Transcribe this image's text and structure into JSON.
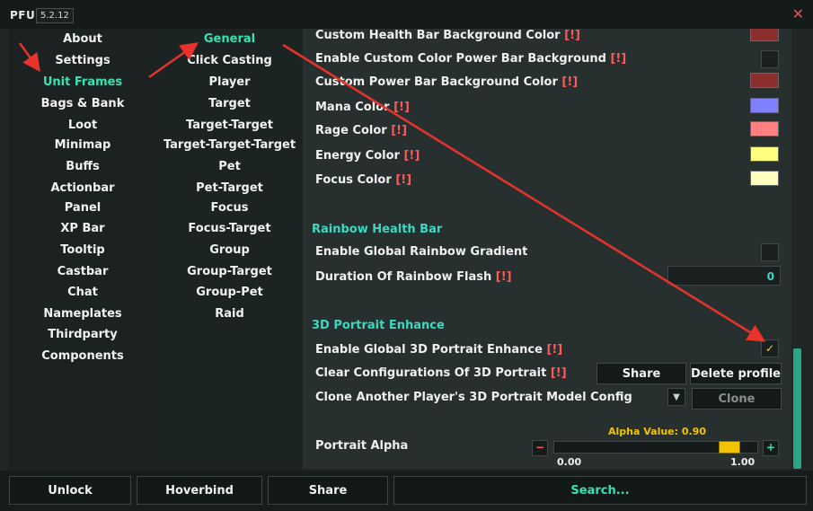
{
  "window": {
    "logo": "PFUI",
    "version": "5.2.12"
  },
  "nav1": {
    "items": [
      "About",
      "Settings",
      "Unit Frames",
      "Bags & Bank",
      "Loot",
      "Minimap",
      "Buffs",
      "Actionbar",
      "Panel",
      "XP Bar",
      "Tooltip",
      "Castbar",
      "Chat",
      "Nameplates",
      "Thirdparty",
      "Components"
    ],
    "active": "Unit Frames"
  },
  "nav2": {
    "items": [
      "General",
      "Click Casting",
      "Player",
      "Target",
      "Target-Target",
      "Target-Target-Target",
      "Pet",
      "Pet-Target",
      "Focus",
      "Focus-Target",
      "Group",
      "Group-Target",
      "Group-Pet",
      "Raid"
    ],
    "active": "General"
  },
  "settings": {
    "color_rows": [
      {
        "label": "Custom Health Bar Background Color",
        "marker": "[!]",
        "color": "#8b2e2e"
      },
      {
        "label": "Enable Custom Color Power Bar Background",
        "marker": "[!]",
        "type": "checkbox",
        "checked": false
      },
      {
        "label": "Custom Power Bar Background Color",
        "marker": "[!]",
        "color": "#8b2e2e"
      },
      {
        "label": "Mana Color",
        "marker": "[!]",
        "color": "#8080ff"
      },
      {
        "label": "Rage Color",
        "marker": "[!]",
        "color": "#ff8080"
      },
      {
        "label": "Energy Color",
        "marker": "[!]",
        "color": "#ffff80"
      },
      {
        "label": "Focus Color",
        "marker": "[!]",
        "color": "#ffffc0"
      }
    ],
    "rainbow_section": "Rainbow Health Bar",
    "rainbow_gradient_label": "Enable Global Rainbow Gradient",
    "rainbow_flash_label": "Duration Of Rainbow Flash",
    "rainbow_flash_marker": "[!]",
    "rainbow_flash_value": "0",
    "portrait_section": "3D Portrait Enhance",
    "portrait_enable_label": "Enable Global 3D Portrait Enhance",
    "portrait_enable_marker": "[!]",
    "portrait_enable_checked": true,
    "clear_label": "Clear Configurations Of 3D Portrait",
    "clear_marker": "[!]",
    "share_label": "Share",
    "delete_label": "Delete profile",
    "clone_row_label": "Clone Another Player's 3D Portrait Model Config",
    "clone_label": "Clone",
    "alpha_label": "Portrait Alpha",
    "alpha_title": "Alpha Value: 0.90",
    "alpha_value": 0.9,
    "alpha_min": "0.00",
    "alpha_max": "1.00",
    "minus": "−",
    "plus": "+"
  },
  "footer": {
    "unlock": "Unlock",
    "hoverbind": "Hoverbind",
    "share": "Share",
    "search": "Search..."
  },
  "colors": {
    "accent": "#36e3b0",
    "warning": "#ff5a5a",
    "slider": "#f3c300",
    "arrow": "#e8322c"
  }
}
